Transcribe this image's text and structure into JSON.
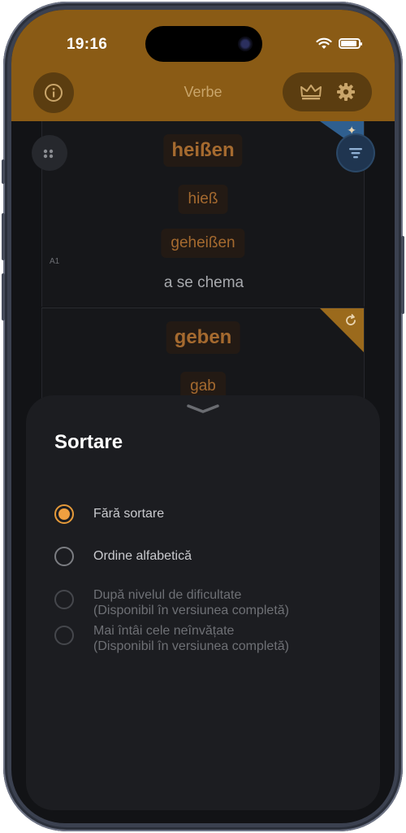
{
  "status_bar": {
    "time": "19:16"
  },
  "app_bar": {
    "title": "Verbe",
    "info_icon": "info-icon",
    "crown_icon": "crown-icon",
    "settings_icon": "gear-icon"
  },
  "cards": [
    {
      "infinitive": "heißen",
      "preterite": "hieß",
      "participle": "geheißen",
      "translation": "a se chema",
      "level": "A1",
      "corner_icon": "sparkle-icon"
    },
    {
      "infinitive": "geben",
      "preterite": "gab",
      "corner_icon": "refresh-icon"
    }
  ],
  "sheet": {
    "title": "Sortare",
    "options": [
      {
        "line1": "Fără sortare",
        "line2": "",
        "selected": true,
        "enabled": true
      },
      {
        "line1": "Ordine alfabetică",
        "line2": "",
        "selected": false,
        "enabled": true
      },
      {
        "line1": "După nivelul de dificultate",
        "line2": "(Disponibil în versiunea completă)",
        "selected": false,
        "enabled": false
      },
      {
        "line1": "Mai întâi cele neînvățate",
        "line2": "(Disponibil în versiunea completă)",
        "selected": false,
        "enabled": false
      }
    ]
  },
  "colors": {
    "header": "#8a5b15",
    "accent": "#f0a040",
    "sheet": "#1c1d21"
  }
}
